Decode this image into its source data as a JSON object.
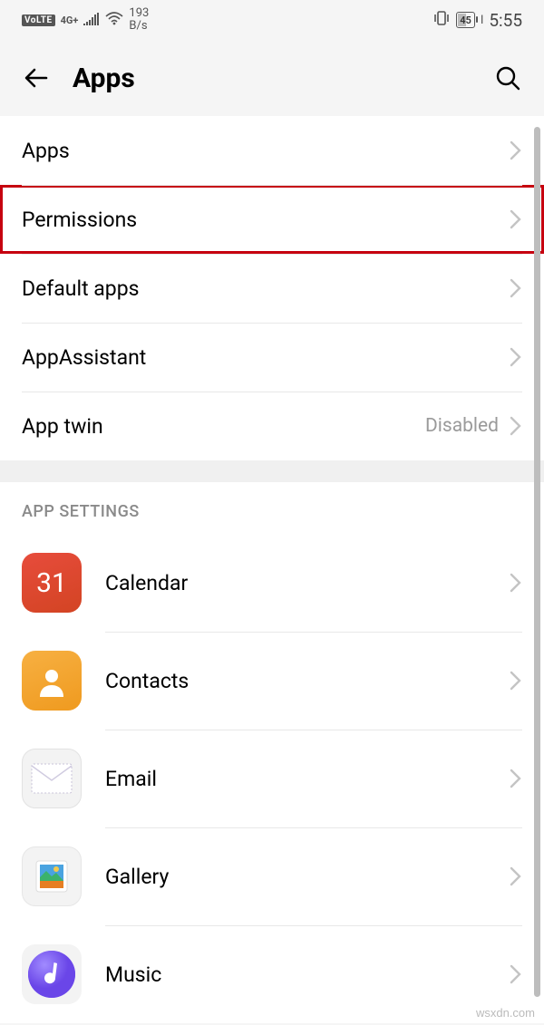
{
  "statusBar": {
    "volte": "VoLTE",
    "netType": "4G+",
    "speedTop": "193",
    "speedBottom": "B/s",
    "battery": "45",
    "time": "5:55"
  },
  "header": {
    "title": "Apps"
  },
  "rows": [
    {
      "label": "Apps",
      "value": "",
      "highlight": false
    },
    {
      "label": "Permissions",
      "value": "",
      "highlight": true
    },
    {
      "label": "Default apps",
      "value": "",
      "highlight": false
    },
    {
      "label": "AppAssistant",
      "value": "",
      "highlight": false
    },
    {
      "label": "App twin",
      "value": "Disabled",
      "highlight": false
    }
  ],
  "sectionTitle": "APP SETTINGS",
  "apps": [
    {
      "label": "Calendar",
      "iconText": "31",
      "iconClass": "ic-calendar"
    },
    {
      "label": "Contacts",
      "iconText": "",
      "iconClass": "ic-contacts"
    },
    {
      "label": "Email",
      "iconText": "",
      "iconClass": "ic-email"
    },
    {
      "label": "Gallery",
      "iconText": "",
      "iconClass": "ic-gallery"
    },
    {
      "label": "Music",
      "iconText": "",
      "iconClass": "ic-music"
    }
  ],
  "watermark": "wsxdn.com"
}
